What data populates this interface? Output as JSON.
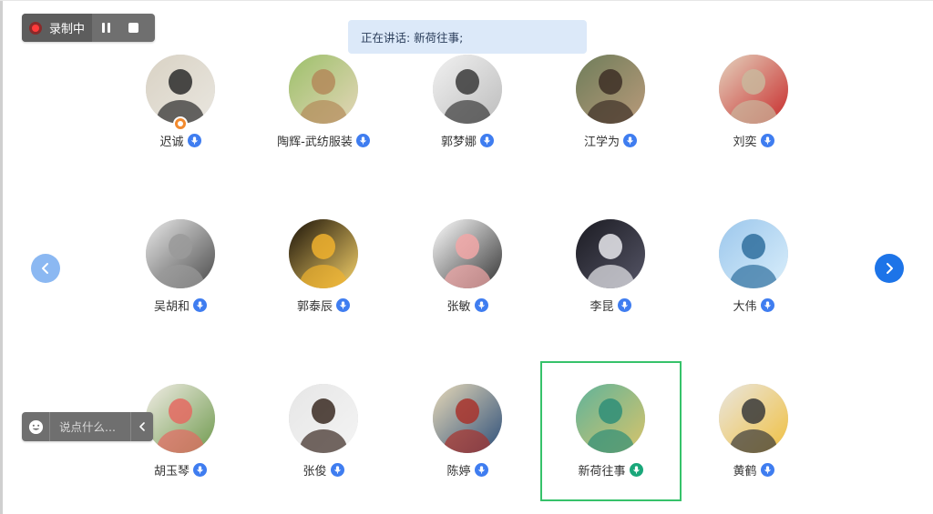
{
  "recording": {
    "status_label": "录制中",
    "pause_icon": "pause-icon",
    "stop_icon": "stop-icon"
  },
  "speaking": {
    "text": "正在讲话: 新荷往事;"
  },
  "participants": [
    {
      "name": "迟诚",
      "host": true,
      "avatar_colors": [
        "#d9d2c4",
        "#2b2b2b",
        "#e9e6df"
      ]
    },
    {
      "name": "陶辉-武纺服装",
      "avatar_colors": [
        "#9cc06a",
        "#b48a5a",
        "#e4d6b8"
      ]
    },
    {
      "name": "郭梦娜",
      "avatar_colors": [
        "#f1f1f1",
        "#3a3a3a",
        "#bdbdbd"
      ]
    },
    {
      "name": "江学为",
      "avatar_colors": [
        "#6e7d5a",
        "#3d2f26",
        "#b99a7a"
      ]
    },
    {
      "name": "刘奕",
      "avatar_colors": [
        "#e4d3be",
        "#c9b79c",
        "#c82b2b"
      ]
    },
    {
      "name": "吴胡和",
      "avatar_colors": [
        "#e9e9e9",
        "#9a9a9a",
        "#4a4a4a"
      ]
    },
    {
      "name": "郭泰辰",
      "avatar_colors": [
        "#1a1208",
        "#f0b22e",
        "#f6d26a"
      ]
    },
    {
      "name": "张敏",
      "avatar_colors": [
        "#ffffff",
        "#f2a7a7",
        "#333333"
      ]
    },
    {
      "name": "李昆",
      "avatar_colors": [
        "#1b1b22",
        "#e8e8ec",
        "#555566"
      ]
    },
    {
      "name": "大伟",
      "avatar_colors": [
        "#9cc7ec",
        "#2f6f9e",
        "#d9eefb"
      ]
    },
    {
      "name": "胡玉琴",
      "avatar_colors": [
        "#f2ede6",
        "#e46a62",
        "#6f9a4e"
      ]
    },
    {
      "name": "张俊",
      "avatar_colors": [
        "#e6e6e6",
        "#3a2a22",
        "#f4f4f4"
      ]
    },
    {
      "name": "陈婷",
      "avatar_colors": [
        "#e7d9b8",
        "#a8322c",
        "#2d4f7a"
      ]
    },
    {
      "name": "新荷往事",
      "speaking": true,
      "avatar_colors": [
        "#5fb39a",
        "#2f8e78",
        "#d9c46a"
      ]
    },
    {
      "name": "黄鹤",
      "avatar_colors": [
        "#e9e6e0",
        "#3a3a3a",
        "#f0c040"
      ]
    }
  ],
  "navigation": {
    "prev_icon": "chevron-left-icon",
    "next_icon": "chevron-right-icon"
  },
  "chat": {
    "placeholder": "说点什么...",
    "emoji_icon": "emoji-icon",
    "collapse_icon": "chevron-left-icon"
  },
  "colors": {
    "accent": "#1d74e8",
    "mic": "#3f7df0",
    "active_mic": "#1aa77a",
    "speaking_frame": "#36c26a",
    "host_badge": "#f28a2e"
  }
}
